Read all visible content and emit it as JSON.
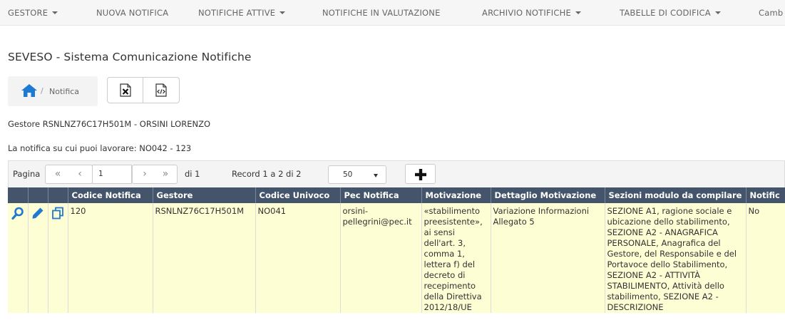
{
  "nav": {
    "items": [
      {
        "label": "GESTORE",
        "caret": true
      },
      {
        "label": "NUOVA NOTIFICA",
        "caret": false
      },
      {
        "label": "NOTIFICHE ATTIVE",
        "caret": true
      },
      {
        "label": "NOTIFICHE IN VALUTAZIONE",
        "caret": false
      },
      {
        "label": "ARCHIVIO NOTIFICHE",
        "caret": true
      },
      {
        "label": "TABELLE DI CODIFICA",
        "caret": true
      },
      {
        "label": "Camb",
        "caret": false
      }
    ]
  },
  "page": {
    "title": "SEVESO - Sistema Comunicazione Notifiche",
    "breadcrumb_sep": "/",
    "breadcrumb_label": "Notifica",
    "gestore_info": "Gestore RSNLNZ76C17H501M - ORSINI LORENZO",
    "notifica_info": "La notifica su cui puoi lavorare: NO042 - 123"
  },
  "pager": {
    "label": "Pagina",
    "first": "«",
    "prev": "‹",
    "current_page": "1",
    "next": "›",
    "last": "»",
    "of_pages": "di 1",
    "record_info": "Record 1 a 2 di 2",
    "page_size": "50"
  },
  "table": {
    "columns": [
      "",
      "",
      "",
      "Codice Notifica",
      "Gestore",
      "Codice Univoco",
      "Pec Notifica",
      "Motivazione",
      "Dettaglio Motivazione",
      "Sezioni modulo da compilare",
      "Notific"
    ],
    "rows": [
      {
        "codice_notifica": "120",
        "gestore": "RSNLNZ76C17H501M",
        "codice_univoco": "NO041",
        "pec_notifica": "orsini-pellegrini@pec.it",
        "motivazione": "«stabilimento preesistente», ai sensi dell'art. 3, comma 1, lettera f) del decreto di recepimento della Direttiva 2012/18/UE",
        "dettaglio_motivazione": "Variazione Informazioni Allegato 5",
        "sezioni": "SEZIONE A1, ragione sociale e ubicazione dello stabilimento, SEZIONE A2 - ANAGRAFICA PERSONALE, Anagrafica del Gestore, del Responsabile e del Portavoce dello Stabilimento, SEZIONE A2 - ATTIVITÀ STABILIMENTO, Attività dello stabilimento, SEZIONE A2 - DESCRIZIONE",
        "notific": "No"
      }
    ]
  },
  "icons": {
    "home": "home-icon",
    "excel": "excel-export-icon",
    "xml": "xml-export-icon",
    "add": "plus-icon",
    "view": "magnifier-icon",
    "edit": "pencil-icon",
    "copy": "copy-icon"
  },
  "colors": {
    "header_bg": "#44546a",
    "row_bg": "#fefed4",
    "icon_blue": "#1f78d1"
  }
}
